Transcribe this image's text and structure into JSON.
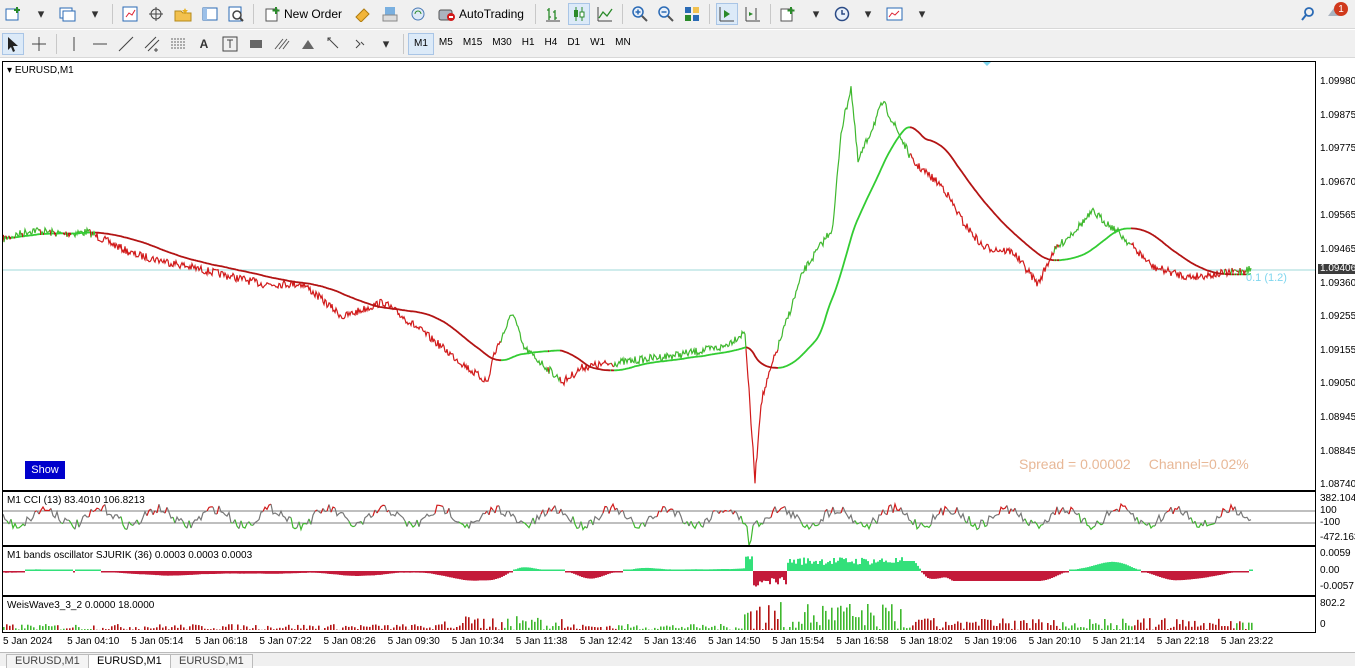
{
  "toolbar": {
    "new_order_label": "New Order",
    "autotrading_label": "AutoTrading",
    "notification_count": "1"
  },
  "timeframes": [
    "M1",
    "M5",
    "M15",
    "M30",
    "H1",
    "H4",
    "D1",
    "W1",
    "MN"
  ],
  "active_timeframe": "M1",
  "chart": {
    "title": "EURUSD,M1",
    "price_labels": [
      "1.09980",
      "1.09875",
      "1.09775",
      "1.09670",
      "1.09565",
      "1.09465",
      "1.09360",
      "1.09255",
      "1.09155",
      "1.09050",
      "1.08945",
      "1.08845",
      "1.08740"
    ],
    "current_price": "1.09406",
    "show_button": "Show",
    "spread_text": "Spread = 0.00002",
    "channel_text": "Channel=0.02%",
    "fib_label": "0.1 (1.2)"
  },
  "cci": {
    "title": "M1 CCI (13) 83.4010 106.8213",
    "labels": [
      "382.104",
      "100",
      "-100",
      "-472.163"
    ]
  },
  "bands": {
    "title": "M1 bands oscillator  SJURIK (36)  0.0003 0.0003 0.0003",
    "labels": [
      "0.0059",
      "0.00",
      "-0.0057"
    ]
  },
  "weis": {
    "title": "WeisWave3_3_2 0.0000 18.0000",
    "labels": [
      "802.2",
      "0"
    ]
  },
  "time_labels": [
    "5 Jan 2024",
    "5 Jan 04:10",
    "5 Jan 05:14",
    "5 Jan 06:18",
    "5 Jan 07:22",
    "5 Jan 08:26",
    "5 Jan 09:30",
    "5 Jan 10:34",
    "5 Jan 11:38",
    "5 Jan 12:42",
    "5 Jan 13:46",
    "5 Jan 14:50",
    "5 Jan 15:54",
    "5 Jan 16:58",
    "5 Jan 18:02",
    "5 Jan 19:06",
    "5 Jan 20:10",
    "5 Jan 21:14",
    "5 Jan 22:18",
    "5 Jan 23:22"
  ],
  "tabs": [
    "EURUSD,M1",
    "EURUSD,M1",
    "EURUSD,M1"
  ],
  "colors": {
    "up": "#3fb82e",
    "down": "#d11a1a",
    "ma_up": "#33cc33",
    "ma_down": "#b31414",
    "band_pos": "#33e07a",
    "band_neg": "#c41a3a",
    "weis_up": "#3fb82e",
    "weis_down": "#b31414"
  }
}
